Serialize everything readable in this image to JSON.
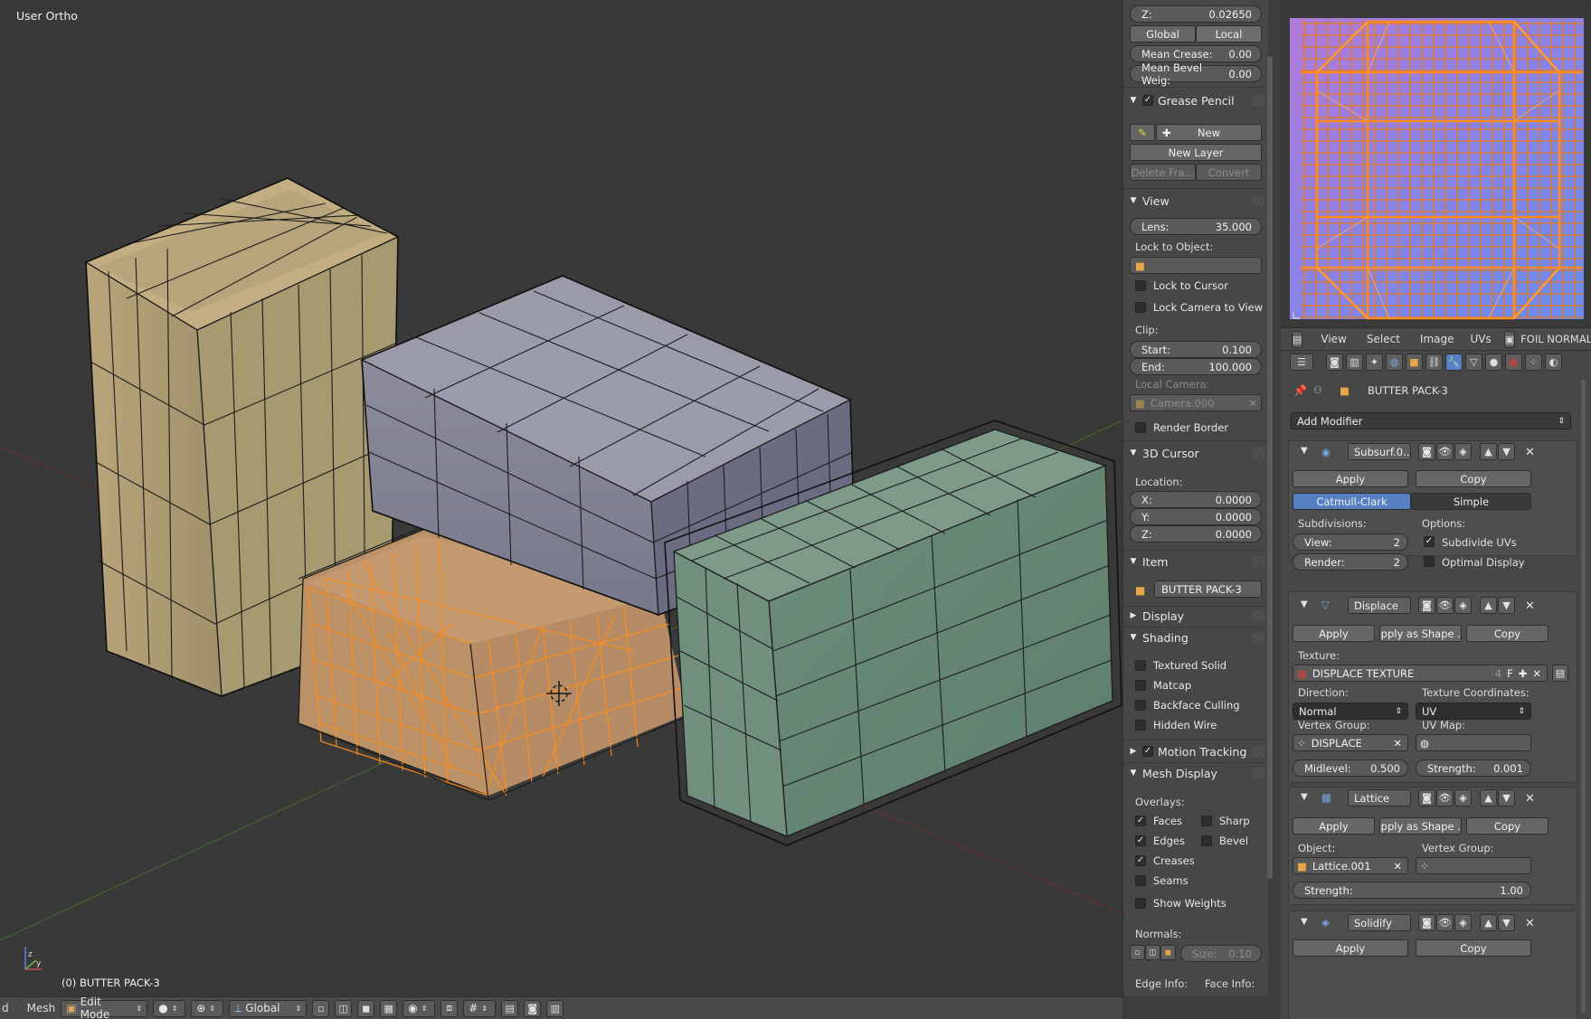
{
  "viewport": {
    "view_name": "User Ortho",
    "object_label": "(0) BUTTER PACK-3"
  },
  "bottom_bar": {
    "menu_cut": "d",
    "menu_mesh": "Mesh",
    "mode": "Edit Mode",
    "orientation": "Global"
  },
  "npanel": {
    "z_label": "Z:",
    "z_value": "0.02650",
    "global_label": "Global",
    "local_label": "Local",
    "mean_crease_label": "Mean Crease:",
    "mean_crease_value": "0.00",
    "mean_bevel_label": "Mean Bevel Weig:",
    "mean_bevel_value": "0.00",
    "grease_pencil": {
      "title": "Grease Pencil",
      "new_label": "New",
      "new_layer_label": "New Layer",
      "delete_frame_label": "Delete Fra...",
      "convert_label": "Convert"
    },
    "view": {
      "title": "View",
      "lens_label": "Lens:",
      "lens_value": "35.000",
      "lock_to_object_label": "Lock to Object:",
      "lock_to_cursor_label": "Lock to Cursor",
      "lock_camera_label": "Lock Camera to View",
      "clip_label": "Clip:",
      "start_label": "Start:",
      "start_value": "0.100",
      "end_label": "End:",
      "end_value": "100.000",
      "local_camera_label": "Local Camera:",
      "local_camera_value": "Camera.000",
      "render_border_label": "Render Border"
    },
    "cursor": {
      "title": "3D Cursor",
      "location_label": "Location:",
      "x_label": "X:",
      "x_value": "0.0000",
      "y_label": "Y:",
      "y_value": "0.0000",
      "z_label": "Z:",
      "z_value": "0.0000"
    },
    "item": {
      "title": "Item",
      "name": "BUTTER PACK-3"
    },
    "display_title": "Display",
    "shading": {
      "title": "Shading",
      "textured_solid": "Textured Solid",
      "matcap": "Matcap",
      "backface_culling": "Backface Culling",
      "hidden_wire": "Hidden Wire"
    },
    "motion_tracking_title": "Motion Tracking",
    "mesh_display": {
      "title": "Mesh Display",
      "overlays_label": "Overlays:",
      "faces": "Faces",
      "sharp": "Sharp",
      "edges": "Edges",
      "bevel": "Bevel",
      "creases": "Creases",
      "seams": "Seams",
      "show_weights": "Show Weights",
      "normals_label": "Normals:",
      "size_label": "Size:",
      "size_value": "0.10",
      "edge_info_label": "Edge Info:",
      "face_info_label": "Face Info:"
    }
  },
  "uv_editor": {
    "menus": [
      "View",
      "Select",
      "Image",
      "UVs"
    ],
    "image_name": "FOIL NORMAL"
  },
  "properties": {
    "object_name": "BUTTER PACK-3",
    "add_modifier_label": "Add Modifier",
    "subsurf": {
      "name": "Subsurf.0...",
      "apply": "Apply",
      "copy": "Copy",
      "catmull_clark": "Catmull-Clark",
      "simple": "Simple",
      "subdivisions_label": "Subdivisions:",
      "options_label": "Options:",
      "view_label": "View:",
      "view_value": "2",
      "render_label": "Render:",
      "render_value": "2",
      "subdivide_uvs": "Subdivide UVs",
      "optimal_display": "Optimal Display"
    },
    "displace": {
      "name": "Displace",
      "apply": "Apply",
      "apply_as_shape": "Apply as Shape ...",
      "copy": "Copy",
      "texture_label": "Texture:",
      "texture_name": "DISPLACE TEXTURE",
      "texture_users": "4",
      "fake_user": "F",
      "direction_label": "Direction:",
      "direction_value": "Normal",
      "texcoord_label": "Texture Coordinates:",
      "texcoord_value": "UV",
      "vgroup_label": "Vertex Group:",
      "vgroup_value": "DISPLACE",
      "uvmap_label": "UV Map:",
      "midlevel_label": "Midlevel:",
      "midlevel_value": "0.500",
      "strength_label": "Strength:",
      "strength_value": "0.001"
    },
    "lattice": {
      "name": "Lattice",
      "apply": "Apply",
      "apply_as_shape": "Apply as Shape ...",
      "copy": "Copy",
      "object_label": "Object:",
      "object_value": "Lattice.001",
      "vgroup_label": "Vertex Group:",
      "strength_label": "Strength:",
      "strength_value": "1.00"
    },
    "solidify": {
      "name": "Solidify",
      "apply": "Apply",
      "copy": "Copy"
    }
  }
}
